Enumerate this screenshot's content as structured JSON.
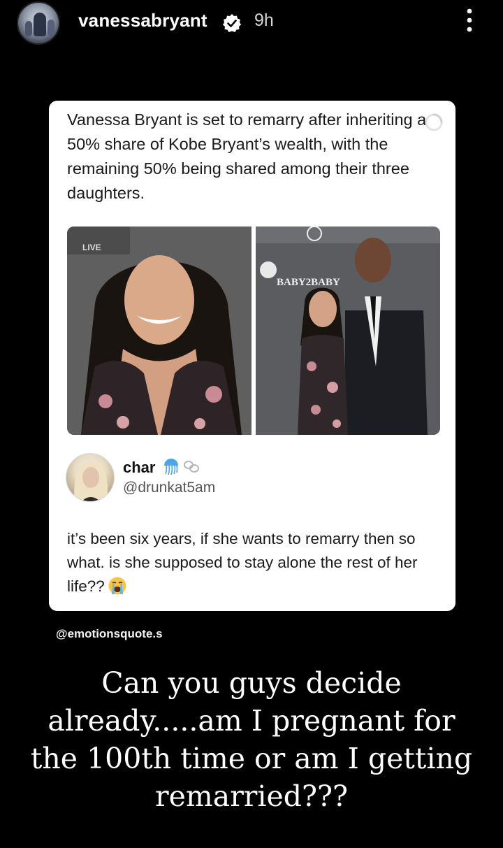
{
  "header": {
    "username": "vanessabryant",
    "timestamp": "9h",
    "verified_icon": "verified-badge-icon",
    "menu_icon": "more-vertical-icon"
  },
  "post_card": {
    "headline": "Vanessa Bryant is set to remarry after inheriting a 50% share of Kobe Bryant’s wealth, with the remaining 50% being shared among their three daughters.",
    "loading_icon": "spinner-icon",
    "photo_left_caption": "LIVE",
    "photo_right_banner": "BABY2BABY",
    "reply": {
      "name": "char",
      "handle": "@drunkat5am",
      "badge_icons": [
        "jellyfish-icon",
        "link-icon"
      ],
      "text": "it’s been six years, if she wants to remarry then so what. is she supposed to stay alone the rest of her life??",
      "emoji": "loudly-crying-face-icon"
    }
  },
  "source_tag": "@emotionsquote.s",
  "caption": "Can you guys decide already.....am I pregnant for the 100th time or am I getting remarried???"
}
